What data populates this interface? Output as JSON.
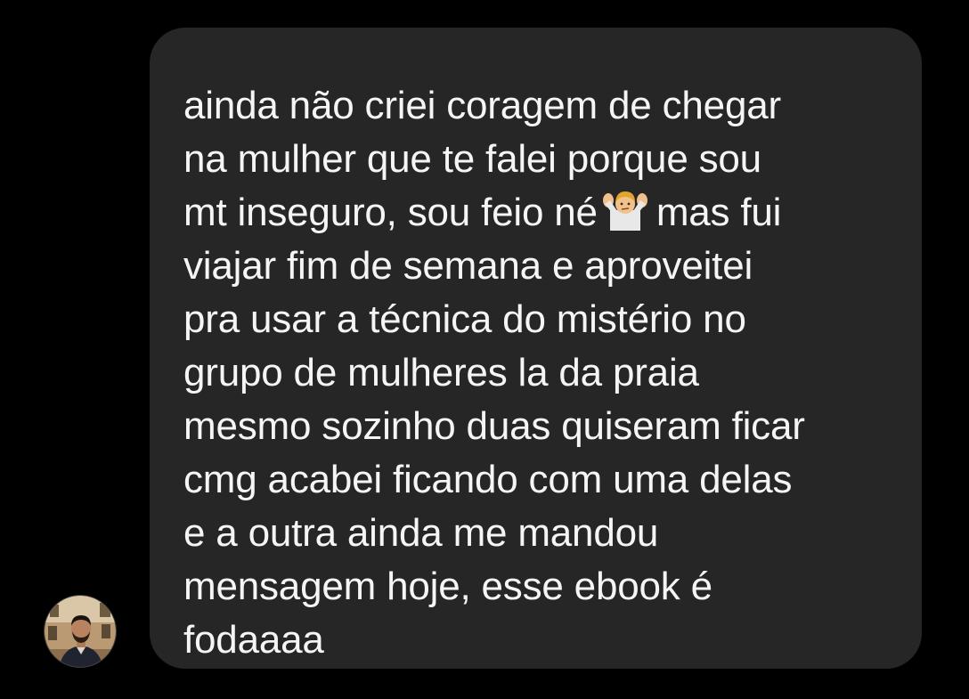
{
  "message": {
    "sender_avatar_icon": "person-avatar-icon",
    "lines": [
      "ainda não criei coragem de chegar",
      "na mulher que te falei porque sou",
      "mt inseguro, sou feio né",
      "viajar fim de semana e aproveitei",
      "pra usar a técnica do mistério no",
      "grupo de mulheres la da praia",
      "mesmo sozinho duas quiseram ficar",
      "cmg acabei ficando com uma delas",
      "e a outra ainda me mandou",
      "mensagem hoje, esse ebook é",
      "fodaaaa"
    ],
    "line3_after_emoji": "mas fui",
    "emoji": "person-shrugging-icon",
    "colors": {
      "background": "#000000",
      "bubble": "#262626",
      "text": "#f5f5f5"
    }
  }
}
